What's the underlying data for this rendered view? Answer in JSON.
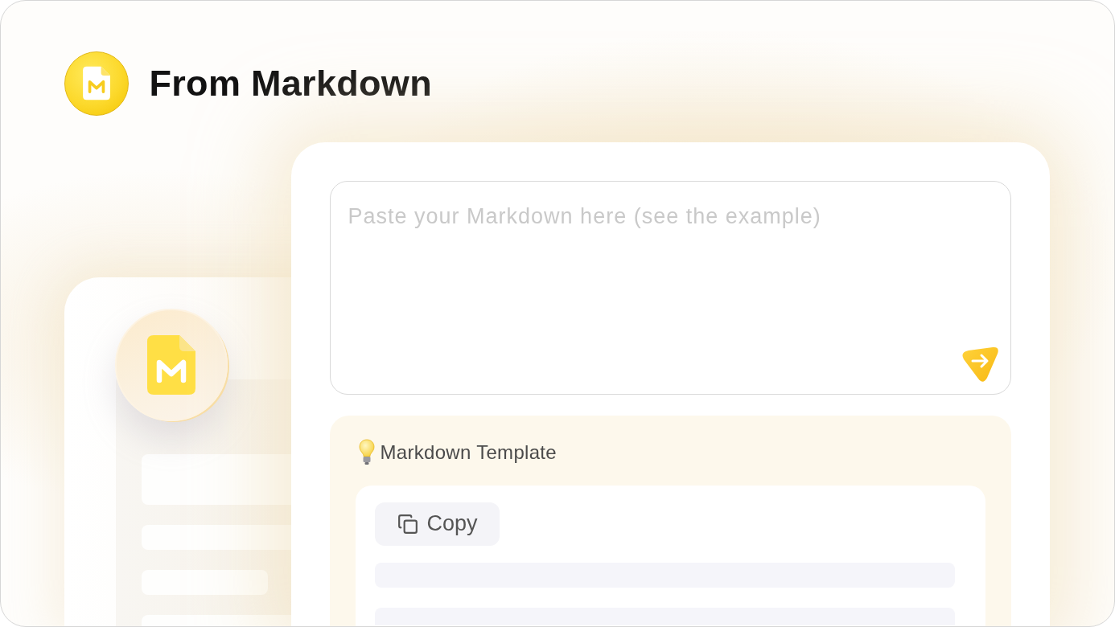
{
  "header": {
    "title": "From Markdown"
  },
  "editor": {
    "placeholder": "Paste your Markdown here (see the example)"
  },
  "template": {
    "title": "Markdown Template",
    "copy_button": "Copy"
  }
}
